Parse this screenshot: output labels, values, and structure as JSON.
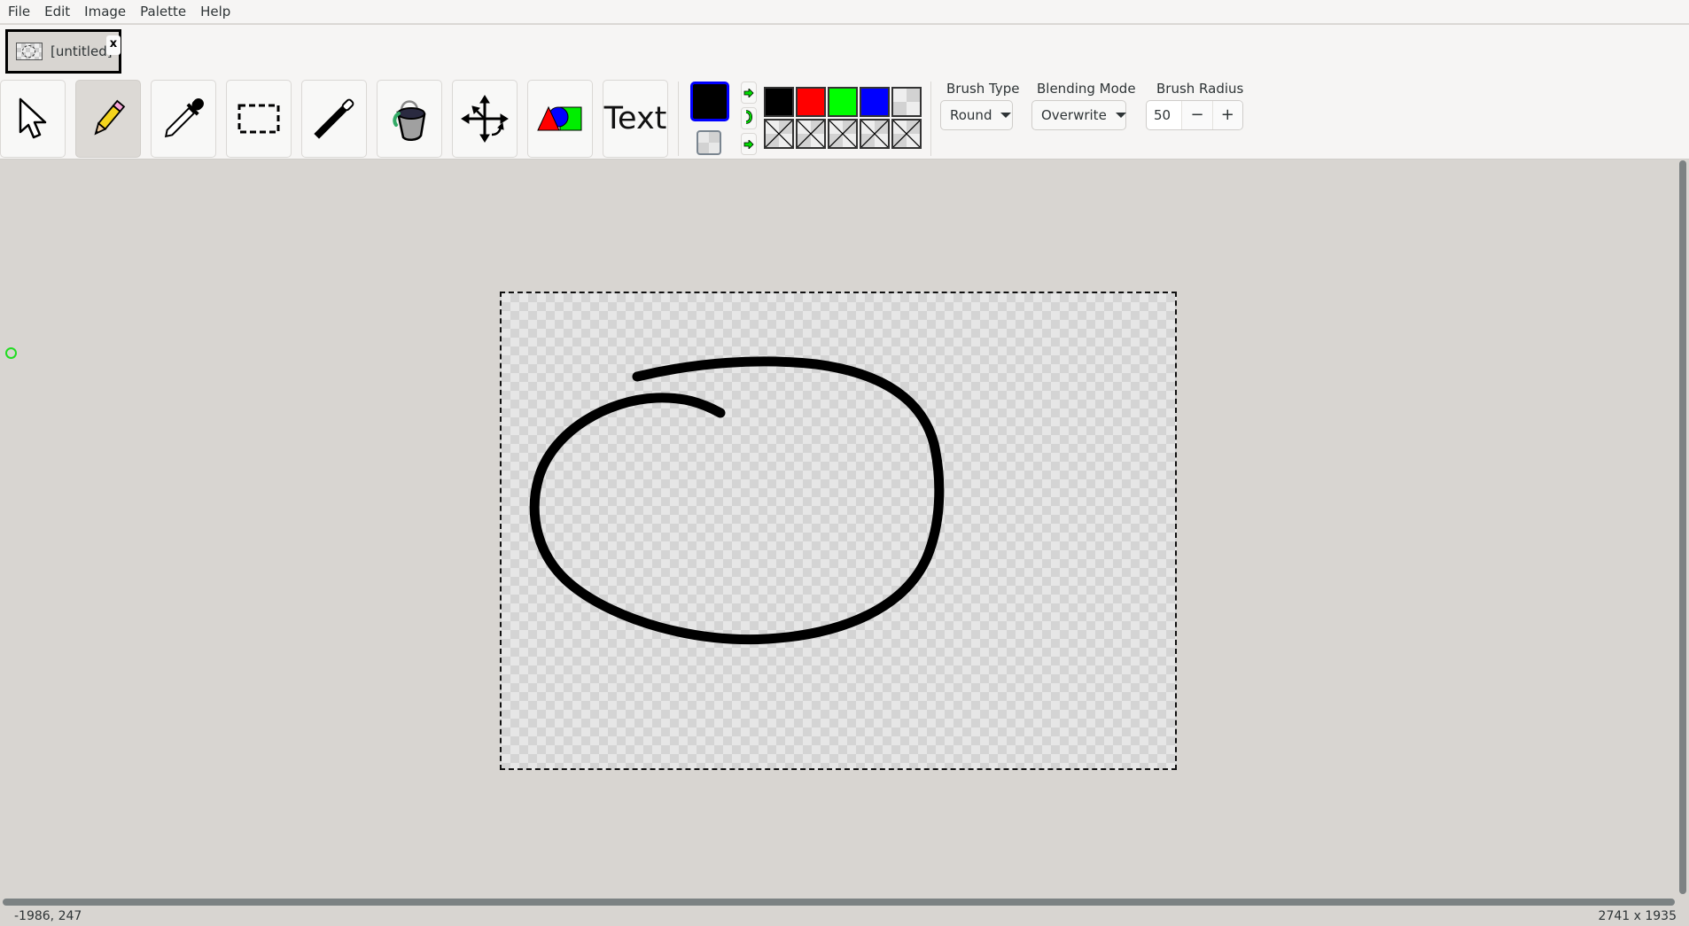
{
  "menu": {
    "items": [
      "File",
      "Edit",
      "Image",
      "Palette",
      "Help"
    ]
  },
  "tabs": [
    {
      "title": "[untitled]",
      "close_label": "x",
      "active": true
    }
  ],
  "toolbar": {
    "tools": [
      {
        "name": "pointer",
        "icon": "pointer-arrow-icon",
        "active": false
      },
      {
        "name": "pencil",
        "icon": "pencil-icon",
        "active": true
      },
      {
        "name": "color-picker",
        "icon": "eyedropper-icon",
        "active": false
      },
      {
        "name": "rectangle-select",
        "icon": "rectangle-select-icon",
        "active": false
      },
      {
        "name": "line",
        "icon": "line-tool-icon",
        "active": false
      },
      {
        "name": "fill",
        "icon": "paint-bucket-icon",
        "active": false
      },
      {
        "name": "move",
        "icon": "move-arrows-icon",
        "active": false
      },
      {
        "name": "shapes",
        "icon": "shapes-icon",
        "active": false
      },
      {
        "name": "text",
        "label": "Text",
        "active": false
      }
    ],
    "colors": {
      "primary": "#000000",
      "primary_border": "#0000ff",
      "secondary": "transparent"
    },
    "palette": {
      "row1": [
        "#000000",
        "#ff0000",
        "#00ff00",
        "#0000ff",
        "transparent"
      ],
      "row2": [
        "empty",
        "empty",
        "empty",
        "empty",
        "empty"
      ]
    },
    "brush_type": {
      "label": "Brush Type",
      "value": "Round"
    },
    "blending_mode": {
      "label": "Blending Mode",
      "value": "Overwrite"
    },
    "brush_radius": {
      "label": "Brush Radius",
      "value": "50",
      "decrement": "−",
      "increment": "+"
    }
  },
  "canvas": {
    "stroke_color": "#000000",
    "cursor_color": "#22dd22"
  },
  "status": {
    "coords": "-1986, 247",
    "image_size": "2741 x 1935"
  }
}
